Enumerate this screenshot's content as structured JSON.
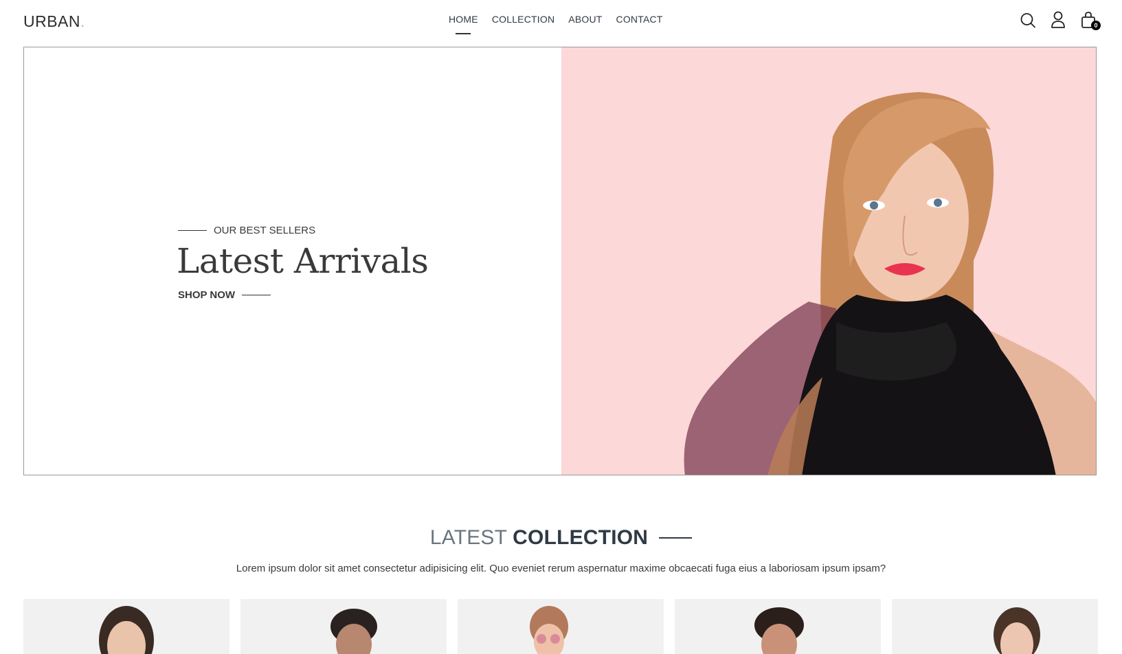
{
  "header": {
    "logo": "URBAN",
    "logo_dot": ".",
    "nav": [
      {
        "label": "HOME",
        "active": true
      },
      {
        "label": "COLLECTION",
        "active": false
      },
      {
        "label": "ABOUT",
        "active": false
      },
      {
        "label": "CONTACT",
        "active": false
      }
    ],
    "icons": [
      "search-icon",
      "user-icon",
      "cart-icon"
    ],
    "cart_count": "0"
  },
  "hero": {
    "eyebrow": "OUR BEST SELLERS",
    "title": "Latest Arrivals",
    "cta": "SHOP NOW",
    "background_color": "#fdd8d8"
  },
  "collection": {
    "title_light": "LATEST",
    "title_bold": "COLLECTION",
    "subtitle": "Lorem ipsum dolor sit amet consectetur adipisicing elit. Quo eveniet rerum aspernatur maxime obcaecati fuga eius a laboriosam ipsum ipsam?",
    "products": [
      {
        "name": "product-1"
      },
      {
        "name": "product-2"
      },
      {
        "name": "product-3"
      },
      {
        "name": "product-4"
      },
      {
        "name": "product-5"
      }
    ]
  }
}
